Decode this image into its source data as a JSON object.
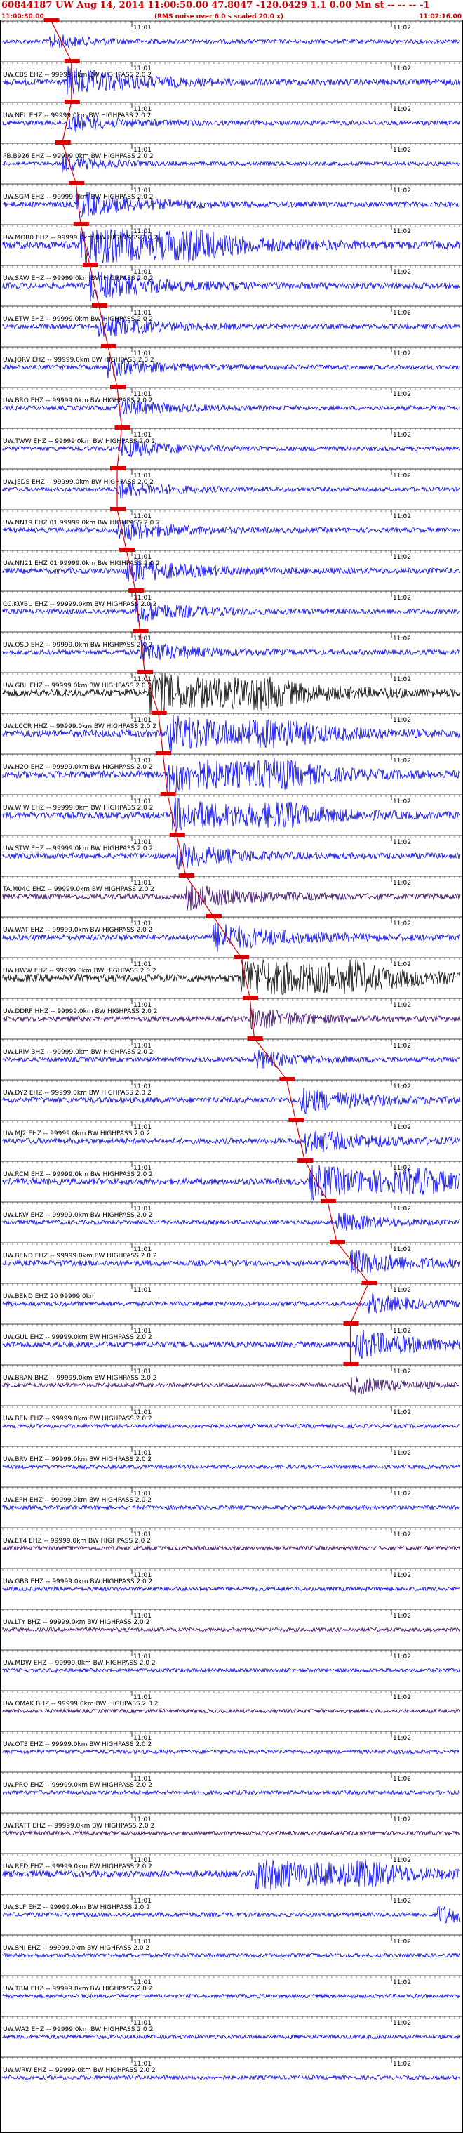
{
  "header": {
    "title": "60844187 UW Aug 14, 2014 11:00:50.00   47.8047 -120.0429  1.1 0.00 Mn st -- -- --   -1",
    "time_start": "11:00:30.00",
    "rms_note": "(RMS noise over 6.0 s scaled 20.0 x)",
    "time_end": "11:02:16.00"
  },
  "time_ticks": {
    "first": "11:01",
    "second": "11:02"
  },
  "colors": {
    "blue": "#0000ee",
    "black": "#000000",
    "purple": "#330066",
    "pick": "#dd0000"
  },
  "traces": [
    {
      "label": "",
      "color": "blue",
      "amp": 0.2,
      "evt": 0.1,
      "pick": 0.105
    },
    {
      "label": "UW.CBS EHZ -- 99999.0km BW HIGHPASS  2.0  2",
      "color": "blue",
      "amp": 0.6,
      "evt": 0.14,
      "pick": 0.15
    },
    {
      "label": "UW.NEL EHZ -- 99999.0km BW HIGHPASS  2.0  2",
      "color": "blue",
      "amp": 0.3,
      "evt": 0.14,
      "pick": 0.15
    },
    {
      "label": "PB.B926 EHZ -- 99999.0km BW HIGHPASS  2.0  2",
      "color": "blue",
      "amp": 0.2,
      "evt": 0.13,
      "pick": 0.13
    },
    {
      "label": "UW.SGM EHZ -- 99999.0km BW HIGHPASS  2.0  2",
      "color": "blue",
      "amp": 0.5,
      "evt": 0.16,
      "pick": 0.16
    },
    {
      "label": "UW.MOR0 EHZ -- 99999.0km BW HIGHPASS  2.0  2",
      "color": "blue",
      "amp": 0.9,
      "evt": 0.17,
      "pick": 0.17
    },
    {
      "label": "UW.SAW EHZ -- 99999.0km BW HIGHPASS  2.0  2",
      "color": "blue",
      "amp": 0.6,
      "evt": 0.19,
      "pick": 0.19
    },
    {
      "label": "UW.ETW EHZ -- 99999.0km BW HIGHPASS  2.0  2",
      "color": "blue",
      "amp": 0.4,
      "evt": 0.21,
      "pick": 0.21
    },
    {
      "label": "UW.JORV EHZ -- 99999.0km BW HIGHPASS  2.0  2",
      "color": "blue",
      "amp": 0.3,
      "evt": 0.23,
      "pick": 0.23
    },
    {
      "label": "UW.BRO EHZ -- 99999.0km BW HIGHPASS  2.0  2",
      "color": "blue",
      "amp": 0.3,
      "evt": 0.25,
      "pick": 0.25
    },
    {
      "label": "UW.TWW EHZ -- 99999.0km BW HIGHPASS  2.0  2",
      "color": "blue",
      "amp": 0.3,
      "evt": 0.26,
      "pick": 0.26
    },
    {
      "label": "UW.JEDS EHZ -- 99999.0km BW HIGHPASS  2.0  2",
      "color": "blue",
      "amp": 0.3,
      "evt": 0.25,
      "pick": 0.25
    },
    {
      "label": "UW.NN19 EHZ 01 99999.0km BW HIGHPASS  2.0  2",
      "color": "blue",
      "amp": 0.4,
      "evt": 0.25,
      "pick": 0.25
    },
    {
      "label": "UW.NN21 EHZ 01 99999.0km BW HIGHPASS  2.0  2",
      "color": "blue",
      "amp": 0.5,
      "evt": 0.27,
      "pick": 0.27
    },
    {
      "label": "CC.KWBU EHZ -- 99999.0km BW HIGHPASS  2.0  2",
      "color": "blue",
      "amp": 0.4,
      "evt": 0.29,
      "pick": 0.29
    },
    {
      "label": "UW.OSD EHZ -- 99999.0km BW HIGHPASS  2.0  2",
      "color": "blue",
      "amp": 0.4,
      "evt": 0.3,
      "pick": 0.3
    },
    {
      "label": "UW.GBL EHZ -- 99999.0km BW HIGHPASS  2.0  2",
      "color": "black",
      "amp": 0.9,
      "evt": 0.32,
      "pick": 0.31
    },
    {
      "label": "UW.LCCR HHZ -- 99999.0km BW HIGHPASS  2.0  2",
      "color": "blue",
      "amp": 0.8,
      "evt": 0.36,
      "pick": 0.34
    },
    {
      "label": "UW.H2O EHZ -- 99999.0km BW HIGHPASS  2.0  2",
      "color": "blue",
      "amp": 0.8,
      "evt": 0.36,
      "pick": 0.35
    },
    {
      "label": "UW.WIW EHZ -- 99999.0km BW HIGHPASS  2.0  2",
      "color": "blue",
      "amp": 0.7,
      "evt": 0.37,
      "pick": 0.36
    },
    {
      "label": "UW.STW EHZ -- 99999.0km BW HIGHPASS  2.0  2",
      "color": "blue",
      "amp": 0.5,
      "evt": 0.38,
      "pick": 0.38
    },
    {
      "label": "TA.M04C EHZ -- 99999.0km BW HIGHPASS  2.0  2",
      "color": "purple",
      "amp": 0.5,
      "evt": 0.4,
      "pick": 0.4
    },
    {
      "label": "UW.WAT EHZ -- 99999.0km BW HIGHPASS  2.0  2",
      "color": "blue",
      "amp": 0.6,
      "evt": 0.46,
      "pick": 0.46
    },
    {
      "label": "UW.HWW EHZ -- 99999.0km BW HIGHPASS  2.0  2",
      "color": "black",
      "amp": 0.9,
      "evt": 0.52,
      "pick": 0.52
    },
    {
      "label": "UW.DDRF HHZ -- 99999.0km BW HIGHPASS  2.0  2",
      "color": "purple",
      "amp": 0.4,
      "evt": 0.54,
      "pick": 0.54
    },
    {
      "label": "UW.LRIV BHZ -- 99999.0km BW HIGHPASS  2.0  2",
      "color": "blue",
      "amp": 0.3,
      "evt": 0.55,
      "pick": 0.55
    },
    {
      "label": "UW.DY2 EHZ -- 99999.0km BW HIGHPASS  2.0  2",
      "color": "blue",
      "amp": 0.5,
      "evt": 0.65,
      "pick": 0.62
    },
    {
      "label": "UW.MJ2 EHZ -- 99999.0km BW HIGHPASS  2.0  2",
      "color": "blue",
      "amp": 0.5,
      "evt": 0.66,
      "pick": 0.64
    },
    {
      "label": "UW.RCM EHZ -- 99999.0km BW HIGHPASS  2.0  2",
      "color": "blue",
      "amp": 0.7,
      "evt": 0.67,
      "pick": 0.66
    },
    {
      "label": "UW.LKW EHZ -- 99999.0km BW HIGHPASS  2.0  2",
      "color": "blue",
      "amp": 0.3,
      "evt": 0.73,
      "pick": 0.71
    },
    {
      "label": "UW.BEND EHZ -- 99999.0km BW HIGHPASS  2.0  2",
      "color": "blue",
      "amp": 0.5,
      "evt": 0.76,
      "pick": 0.73
    },
    {
      "label": "UW.BEND EHZ 20 99999.0km",
      "color": "blue",
      "amp": 0.3,
      "evt": 0.8,
      "pick": 0.8
    },
    {
      "label": "UW.GUL EHZ -- 99999.0km BW HIGHPASS  2.0  2",
      "color": "blue",
      "amp": 0.6,
      "evt": 0.77,
      "pick": 0.76
    },
    {
      "label": "UW.BRAN BHZ -- 99999.0km BW HIGHPASS  2.0  2",
      "color": "purple",
      "amp": 0.3,
      "evt": 0.76,
      "pick": 0.76
    },
    {
      "label": "UW.BEN EHZ -- 99999.0km BW HIGHPASS  2.0  2",
      "color": "blue",
      "amp": 0.2,
      "evt": -1,
      "pick": -1
    },
    {
      "label": "UW.BRV EHZ -- 99999.0km BW HIGHPASS  2.0  2",
      "color": "blue",
      "amp": 0.2,
      "evt": -1,
      "pick": -1
    },
    {
      "label": "UW.EPH EHZ -- 99999.0km BW HIGHPASS  2.0  2",
      "color": "blue",
      "amp": 0.2,
      "evt": -1,
      "pick": -1
    },
    {
      "label": "UW.ET4 EHZ -- 99999.0km BW HIGHPASS  2.0  2",
      "color": "purple",
      "amp": 0.2,
      "evt": -1,
      "pick": -1
    },
    {
      "label": "UW.GBB EHZ -- 99999.0km BW HIGHPASS  2.0  2",
      "color": "blue",
      "amp": 0.2,
      "evt": -1,
      "pick": -1
    },
    {
      "label": "UW.LTY BHZ -- 99999.0km BW HIGHPASS  2.0  2",
      "color": "purple",
      "amp": 0.2,
      "evt": -1,
      "pick": -1
    },
    {
      "label": "UW.MDW EHZ -- 99999.0km BW HIGHPASS  2.0  2",
      "color": "blue",
      "amp": 0.2,
      "evt": -1,
      "pick": -1
    },
    {
      "label": "UW.OMAK BHZ -- 99999.0km BW HIGHPASS  2.0  2",
      "color": "purple",
      "amp": 0.2,
      "evt": -1,
      "pick": -1
    },
    {
      "label": "UW.OT3 EHZ -- 99999.0km BW HIGHPASS  2.0  2",
      "color": "blue",
      "amp": 0.2,
      "evt": -1,
      "pick": -1
    },
    {
      "label": "UW.PRO EHZ -- 99999.0km BW HIGHPASS  2.0  2",
      "color": "blue",
      "amp": 0.2,
      "evt": -1,
      "pick": -1
    },
    {
      "label": "UW.RATT EHZ -- 99999.0km BW HIGHPASS  2.0  2",
      "color": "purple",
      "amp": 0.2,
      "evt": -1,
      "pick": -1
    },
    {
      "label": "UW.RED EHZ -- 99999.0km BW HIGHPASS  2.0  2",
      "color": "blue",
      "amp": 0.7,
      "evt": 0.55,
      "pick": -1
    },
    {
      "label": "UW.SLF EHZ -- 99999.0km BW HIGHPASS  2.0  2",
      "color": "blue",
      "amp": 0.3,
      "evt": 0.95,
      "pick": -1
    },
    {
      "label": "UW.SNI EHZ -- 99999.0km BW HIGHPASS  2.0  2",
      "color": "blue",
      "amp": 0.2,
      "evt": -1,
      "pick": -1
    },
    {
      "label": "UW.TBM EHZ -- 99999.0km BW HIGHPASS  2.0  2",
      "color": "blue",
      "amp": 0.2,
      "evt": -1,
      "pick": -1
    },
    {
      "label": "UW.WA2 EHZ -- 99999.0km BW HIGHPASS  2.0  2",
      "color": "blue",
      "amp": 0.2,
      "evt": -1,
      "pick": -1
    },
    {
      "label": "UW.WRW EHZ -- 99999.0km BW HIGHPASS  2.0  2",
      "color": "blue",
      "amp": 0.2,
      "evt": -1,
      "pick": -1
    }
  ]
}
